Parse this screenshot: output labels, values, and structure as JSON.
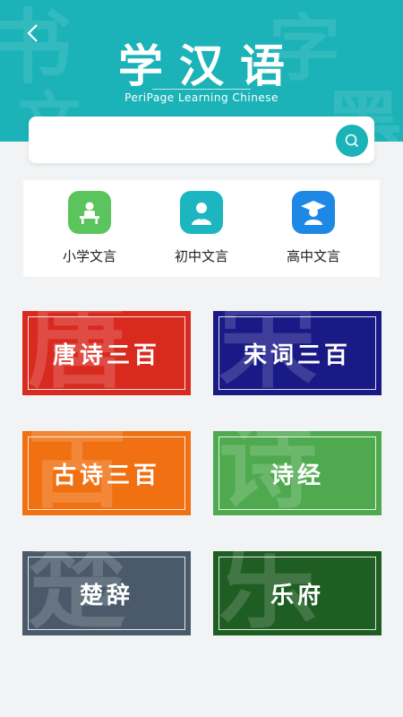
{
  "header": {
    "back_icon": "chevron-left-icon",
    "title": "学汉语",
    "subtitle": "PeriPage Learning Chinese",
    "color": "#1bb3b8"
  },
  "search": {
    "value": "",
    "placeholder": "",
    "icon": "search-icon"
  },
  "levels": [
    {
      "label": "小学文言",
      "icon": "student-desk-icon",
      "color": "#5cc45c"
    },
    {
      "label": "初中文言",
      "icon": "student-avatar-icon",
      "color": "#1cb6c1"
    },
    {
      "label": "高中文言",
      "icon": "graduate-cap-icon",
      "color": "#1e88e5"
    }
  ],
  "cards": [
    {
      "label": "唐诗三百",
      "watermark": "唐",
      "color": "#d92a20"
    },
    {
      "label": "宋词三百",
      "watermark": "宋",
      "color": "#1a1a87"
    },
    {
      "label": "古诗三百",
      "watermark": "古",
      "color": "#f07012"
    },
    {
      "label": "诗经",
      "watermark": "诗",
      "color": "#4faa4f"
    },
    {
      "label": "楚辞",
      "watermark": "楚",
      "color": "#4a5a6a"
    },
    {
      "label": "乐府",
      "watermark": "乐",
      "color": "#1e5e22"
    }
  ]
}
